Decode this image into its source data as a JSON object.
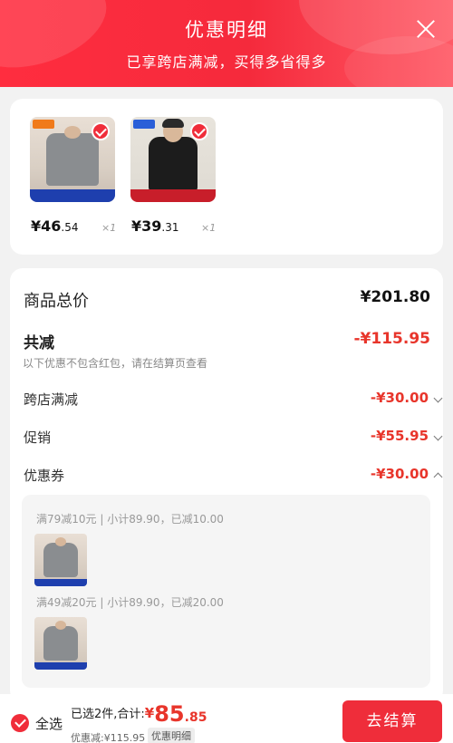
{
  "header": {
    "title": "优惠明细",
    "subtitle": "已享跨店满减，买得多省得多",
    "close_icon": "close-icon"
  },
  "items": [
    {
      "price_int": "¥46",
      "price_dec": ".54",
      "qty": "×1",
      "selected": true
    },
    {
      "price_int": "¥39",
      "price_dec": ".31",
      "qty": "×1",
      "selected": true
    }
  ],
  "summary": {
    "total_label": "商品总价",
    "total_value": "¥201.80",
    "reduce_label": "共减",
    "reduce_value": "-¥115.95",
    "note": "以下优惠不包含红包，请在结算页查看",
    "lines": [
      {
        "label": "跨店满减",
        "value": "-¥30.00",
        "expanded": false
      },
      {
        "label": "促销",
        "value": "-¥55.95",
        "expanded": false
      },
      {
        "label": "优惠券",
        "value": "-¥30.00",
        "expanded": true
      }
    ],
    "coupons": [
      {
        "text": "满79减10元 | 小计89.90，已减10.00"
      },
      {
        "text": "满49减20元 | 小计89.90，已减20.00"
      }
    ]
  },
  "footer": {
    "select_all": "全选",
    "sum_prefix": "已选2件,合计:",
    "sum_yen": "¥",
    "sum_int": "85",
    "sum_dec": ".85",
    "reduce_text": "优惠减:¥115.95",
    "detail_chip": "优惠明细",
    "checkout": "去结算"
  },
  "colors": {
    "accent": "#ef2d3a",
    "price_red": "#e8352b"
  }
}
